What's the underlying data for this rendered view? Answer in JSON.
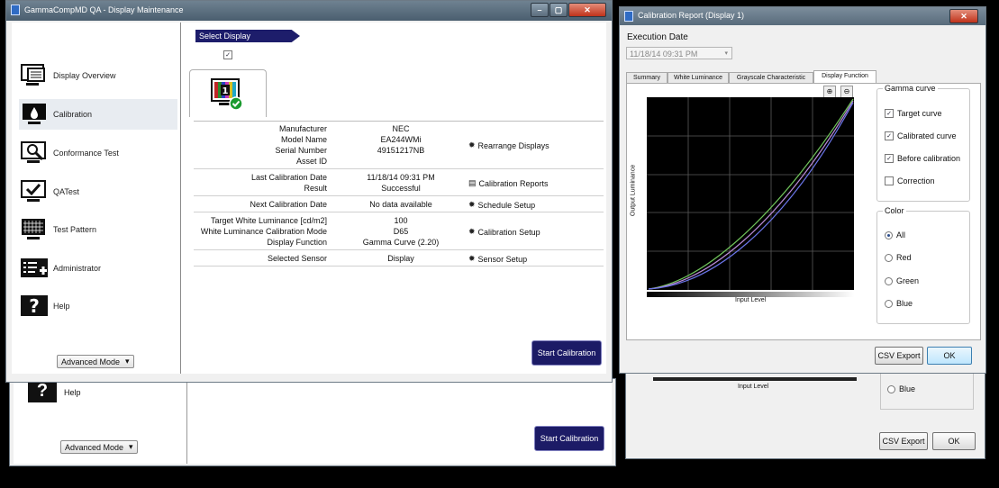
{
  "main_window": {
    "title": "GammaCompMD QA - Display Maintenance",
    "sidebar": [
      {
        "label": "Display Overview",
        "icon": "display-overview-icon"
      },
      {
        "label": "Calibration",
        "icon": "calibration-icon",
        "selected": true
      },
      {
        "label": "Conformance Test",
        "icon": "conformance-test-icon"
      },
      {
        "label": "QATest",
        "icon": "qa-test-icon"
      },
      {
        "label": "Test Pattern",
        "icon": "test-pattern-icon"
      },
      {
        "label": "Administrator",
        "icon": "administrator-icon"
      },
      {
        "label": "Help",
        "icon": "help-icon"
      }
    ],
    "mode_select": "Advanced Mode",
    "select_display_label": "Select Display",
    "display_number": "1",
    "info": {
      "manufacturer_label": "Manufacturer",
      "manufacturer": "NEC",
      "model_label": "Model Name",
      "model": "EA244WMi",
      "serial_label": "Serial Number",
      "serial": "49151217NB",
      "asset_label": "Asset ID",
      "asset": "",
      "rearrange": "Rearrange Displays",
      "last_cal_label": "Last Calibration Date",
      "last_cal": "11/18/14 09:31 PM",
      "result_label": "Result",
      "result": "Successful",
      "cal_reports": "Calibration Reports",
      "next_cal_label": "Next Calibration Date",
      "next_cal": "No data available",
      "schedule": "Schedule Setup",
      "target_lum_label": "Target White Luminance [cd/m2]",
      "target_lum": "100",
      "wl_mode_label": "White Luminance Calibration Mode",
      "wl_mode": "D65",
      "display_func_label": "Display Function",
      "display_func": "Gamma Curve (2.20)",
      "cal_setup": "Calibration Setup",
      "sensor_label": "Selected Sensor",
      "sensor": "Display",
      "sensor_setup": "Sensor Setup"
    },
    "start_button": "Start Calibration"
  },
  "ghost_window": {
    "help_label": "Help",
    "mode_select": "Advanced Mode",
    "start_button": "Start Calibration",
    "input_level": "Input Level",
    "blue": "Blue",
    "csv_export": "CSV Export",
    "ok": "OK"
  },
  "report_window": {
    "title": "Calibration Report (Display 1)",
    "execution_date_label": "Execution Date",
    "execution_date": "11/18/14 09:31 PM",
    "tabs": [
      "Summary",
      "White Luminance",
      "Grayscale Characteristic",
      "Display Function"
    ],
    "active_tab": 3,
    "y_axis_label": "Output Luminance",
    "x_axis_label": "Input Level",
    "gamma_group": "Gamma curve",
    "gamma_options": [
      {
        "label": "Target curve",
        "checked": true
      },
      {
        "label": "Calibrated curve",
        "checked": true
      },
      {
        "label": "Before calibration",
        "checked": true
      },
      {
        "label": "Correction",
        "checked": false
      }
    ],
    "color_group": "Color",
    "color_options": [
      {
        "label": "All",
        "selected": true
      },
      {
        "label": "Red",
        "selected": false
      },
      {
        "label": "Green",
        "selected": false
      },
      {
        "label": "Blue",
        "selected": false
      }
    ],
    "csv_export": "CSV Export",
    "ok": "OK"
  },
  "colors": {
    "accent": "#1c1b66",
    "curve_green": "#6fc25a",
    "curve_blue": "#6a74e8",
    "curve_purple": "#b88ad6"
  }
}
